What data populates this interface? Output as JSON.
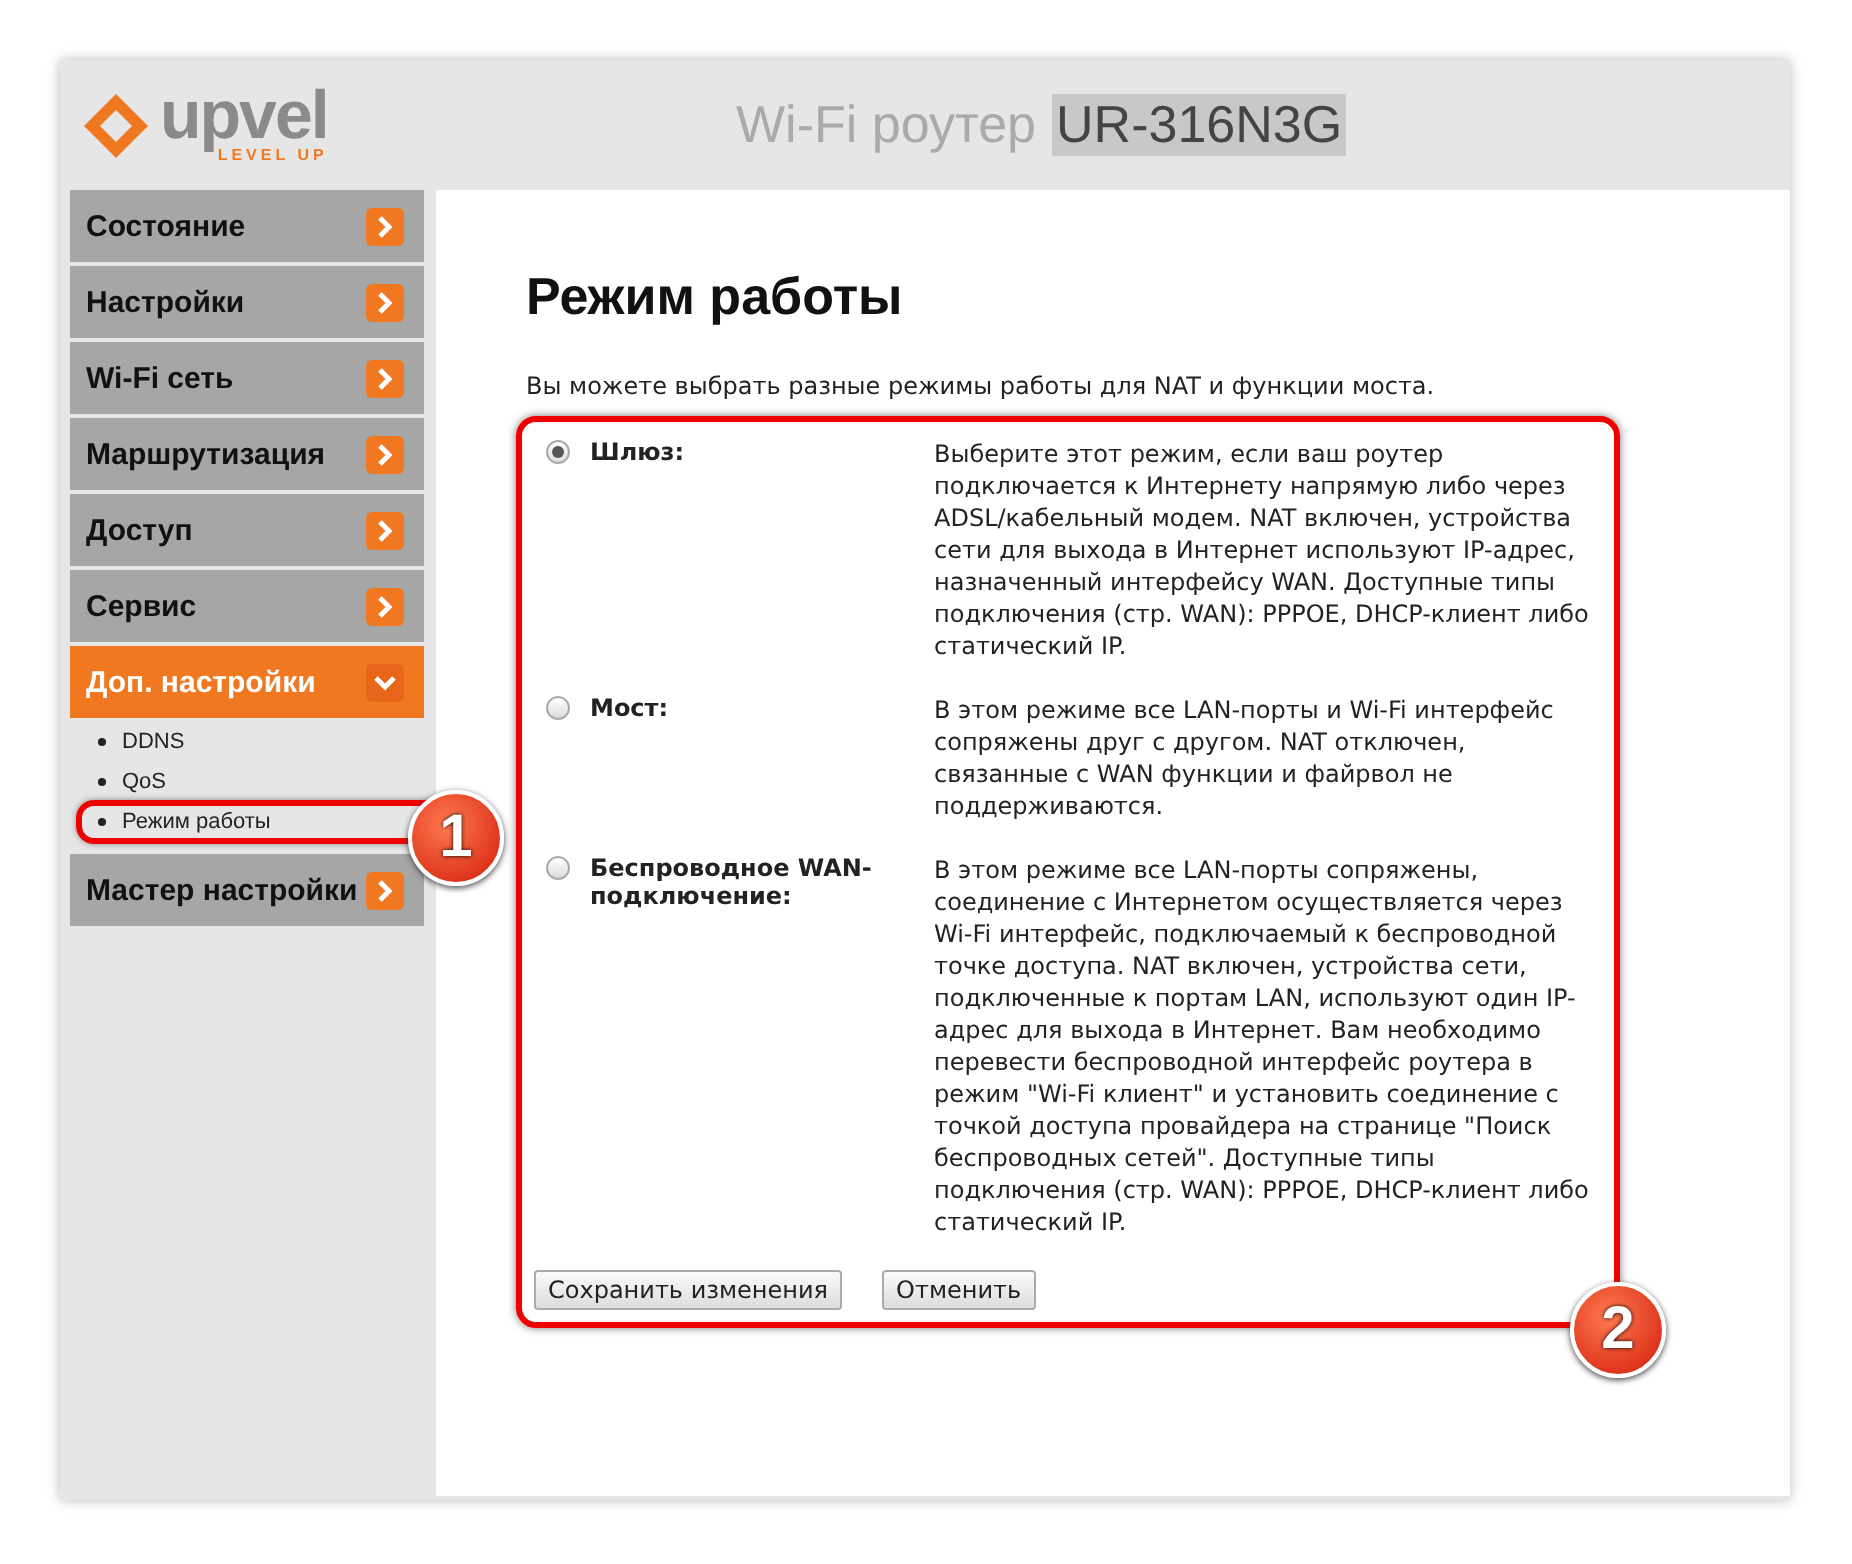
{
  "header": {
    "logo_text": "upvel",
    "logo_tagline": "LEVEL UP",
    "title": "Wi-Fi роутер",
    "model": "UR-316N3G"
  },
  "sidebar": {
    "items": [
      {
        "label": "Состояние",
        "expanded": false
      },
      {
        "label": "Настройки",
        "expanded": false
      },
      {
        "label": "Wi-Fi сеть",
        "expanded": false
      },
      {
        "label": "Маршрутизация",
        "expanded": false
      },
      {
        "label": "Доступ",
        "expanded": false
      },
      {
        "label": "Сервис",
        "expanded": false
      },
      {
        "label": "Доп. настройки",
        "expanded": true,
        "children": [
          {
            "label": "DDNS"
          },
          {
            "label": "QoS"
          },
          {
            "label": "Режим работы",
            "callout": "1"
          }
        ]
      },
      {
        "label": "Мастер настройки",
        "expanded": false
      }
    ]
  },
  "content": {
    "heading": "Режим работы",
    "intro": "Вы можете выбрать разные режимы работы для NAT и функции моста.",
    "form": {
      "callout": "2",
      "modes": [
        {
          "label": "Шлюз:",
          "selected": true,
          "description": "Выберите этот режим, если ваш роутер подключается к Интернету напрямую либо через ADSL/кабельный модем. NAT включен, устройства сети для выхода в Интернет используют IP-адрес, назначенный интерфейсу WAN. Доступные типы подключения (стр. WAN): PPPOE, DHCP-клиент либо статический IP."
        },
        {
          "label": "Мост:",
          "selected": false,
          "description": "В этом режиме все LAN-порты и Wi-Fi интерфейс сопряжены друг с другом. NAT отключен, связанные с WAN функции и файрвол не поддерживаются."
        },
        {
          "label": "Беспроводное WAN-подключение:",
          "selected": false,
          "description": "В этом режиме все LAN-порты сопряжены, соединение с Интернетом осуществляется через Wi-Fi интерфейс, подключаемый к беспроводной точке доступа. NAT включен, устройства сети, подключенные к портам LAN, используют один IP-адрес для выхода в Интернет. Вам необходимо перевести беспроводной интерфейс роутера в режим \"Wi-Fi клиент\" и установить соединение с точкой доступа провайдера на странице \"Поиск беспроводных сетей\". Доступные типы подключения (стр. WAN): PPPOE, DHCP-клиент либо статический IP."
        }
      ],
      "buttons": [
        "Сохранить изменения",
        "Отменить"
      ]
    }
  }
}
